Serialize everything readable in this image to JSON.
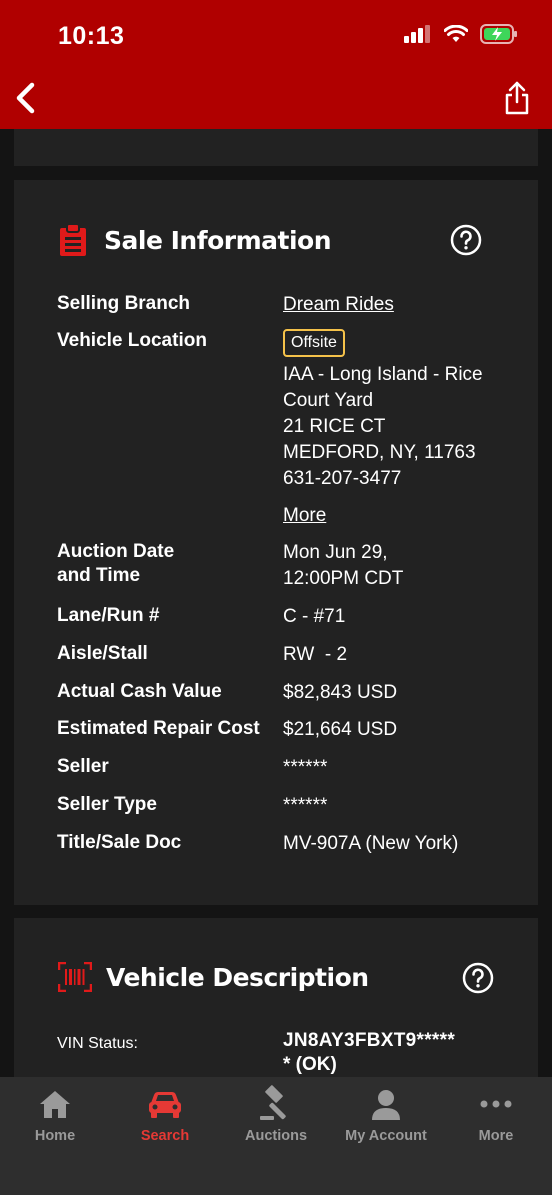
{
  "status_bar": {
    "time": "10:13"
  },
  "sale_info": {
    "title": "Sale Information",
    "rows": {
      "selling_branch": {
        "label": "Selling Branch",
        "value": "Dream Rides"
      },
      "vehicle_location": {
        "label": "Vehicle Location",
        "badge": "Offsite",
        "lines": [
          "IAA - Long Island - Rice",
          "Court Yard",
          "21 RICE CT",
          "MEDFORD, NY, 11763",
          "631-207-3477"
        ],
        "more": "More"
      },
      "auction_date": {
        "label_line1": "Auction Date",
        "label_line2": "and Time",
        "value_line1": "Mon Jun 29,",
        "value_line2": "12:00PM CDT"
      },
      "lane_run": {
        "label": "Lane/Run #",
        "value": "C - #71"
      },
      "aisle_stall": {
        "label": "Aisle/Stall",
        "value": "RW  - 2"
      },
      "actual_cash_value": {
        "label": "Actual Cash Value",
        "value": "$82,843 USD"
      },
      "estimated_repair_cost": {
        "label": "Estimated Repair Cost",
        "value": "$21,664 USD"
      },
      "seller": {
        "label": "Seller",
        "value": "******"
      },
      "seller_type": {
        "label": "Seller Type",
        "value": "******"
      },
      "title_sale_doc": {
        "label": "Title/Sale Doc",
        "value": "MV-907A (New York)"
      }
    }
  },
  "vehicle_description": {
    "title": "Vehicle Description",
    "vin_label": "VIN Status:",
    "vin_value_line1": "JN8AY3FBXT9*****",
    "vin_value_line2": "* (OK)"
  },
  "bottom_nav": [
    {
      "label": "Home",
      "icon": "home-icon",
      "active": false
    },
    {
      "label": "Search",
      "icon": "car-icon",
      "active": true
    },
    {
      "label": "Auctions",
      "icon": "gavel-icon",
      "active": false
    },
    {
      "label": "My Account",
      "icon": "person-icon",
      "active": false
    },
    {
      "label": "More",
      "icon": "more-dots-icon",
      "active": false
    }
  ],
  "colors": {
    "brand_red": "#b00000",
    "active_red": "#e53935",
    "badge_border": "#f5c24a",
    "card_bg": "#222222",
    "page_bg": "#141414"
  }
}
